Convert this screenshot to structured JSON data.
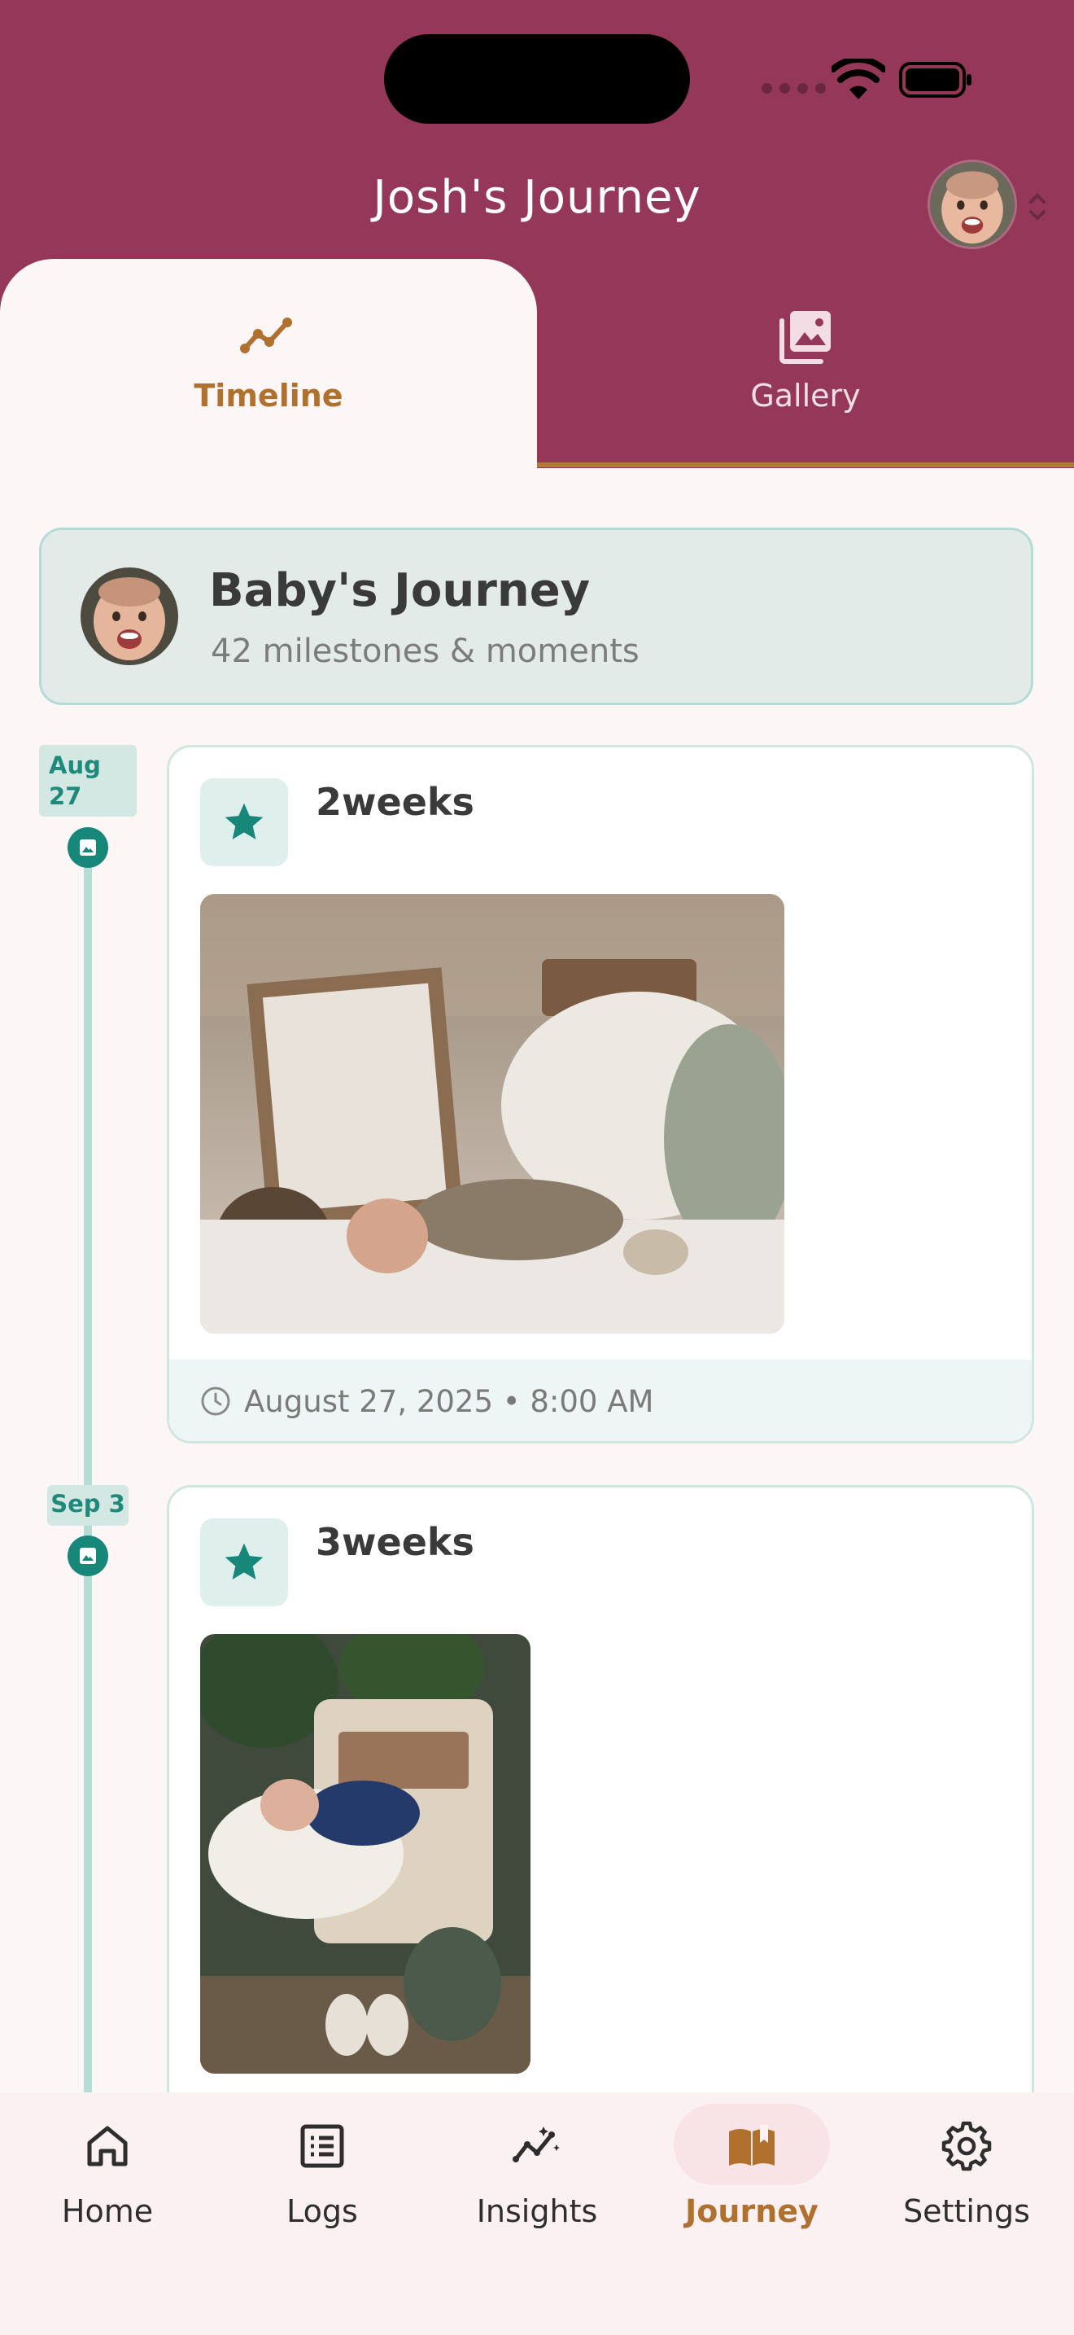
{
  "app": {
    "title": "Josh's Journey",
    "colors": {
      "header": "#943758",
      "accent": "#b0702e",
      "teal": "#17877a"
    }
  },
  "tabs": [
    {
      "label": "Timeline",
      "icon": "trending-icon",
      "active": true
    },
    {
      "label": "Gallery",
      "icon": "photo-library-icon",
      "active": false
    }
  ],
  "summary": {
    "title": "Baby's Journey",
    "subtitle": "42 milestones & moments"
  },
  "entries": [
    {
      "date": "Aug 27",
      "title": "2weeks",
      "timestamp": "August 27, 2025 • 8:00 AM",
      "icon": "star-icon"
    },
    {
      "date": "Sep 3",
      "title": "3weeks",
      "icon": "star-icon"
    }
  ],
  "nav": [
    {
      "label": "Home",
      "icon": "home-icon"
    },
    {
      "label": "Logs",
      "icon": "list-icon"
    },
    {
      "label": "Insights",
      "icon": "insights-icon"
    },
    {
      "label": "Journey",
      "icon": "book-icon",
      "active": true
    },
    {
      "label": "Settings",
      "icon": "gear-icon"
    }
  ]
}
